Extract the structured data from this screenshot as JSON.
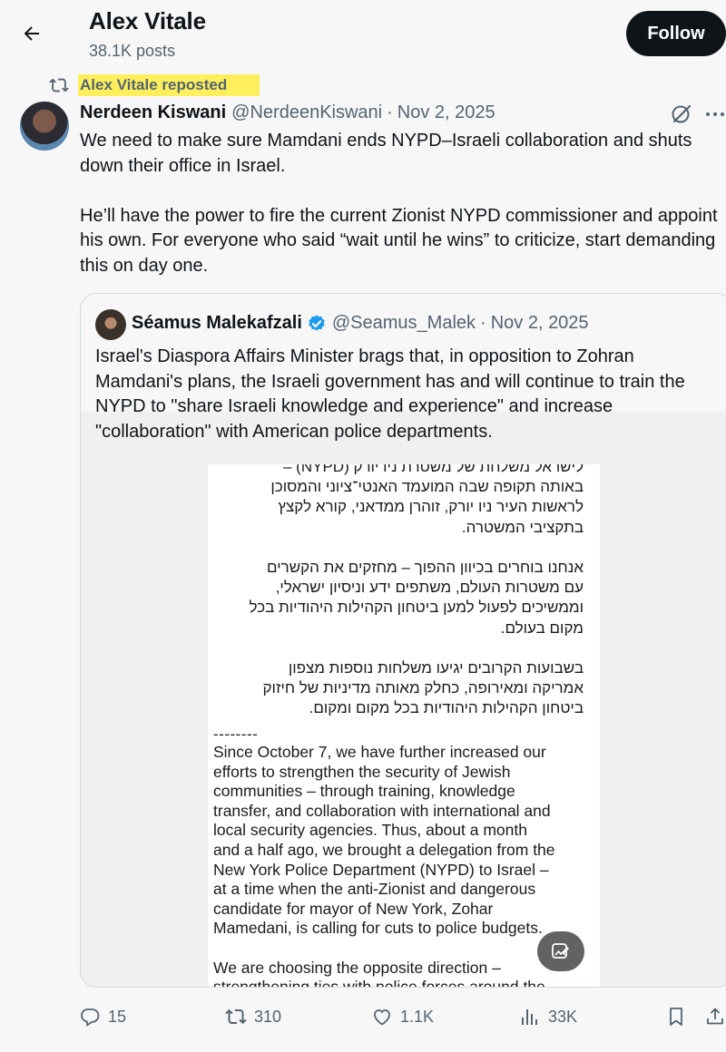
{
  "header": {
    "title": "Alex Vitale",
    "subtitle": "38.1K posts",
    "follow_label": "Follow"
  },
  "repost": {
    "text": "Alex Vitale reposted",
    "highlight_color": "#ffef5c"
  },
  "tweet": {
    "author_name": "Nerdeen Kiswani",
    "author_handle": "@NerdeenKiswani",
    "separator": "·",
    "date": "Nov 2, 2025",
    "paragraph_1": "We need to make sure Mamdani ends NYPD–Israeli collaboration and shuts down their office in Israel.",
    "paragraph_2": "He’ll have the power to fire the current Zionist NYPD commissioner and appoint his own. For everyone who said “wait until he wins” to criticize, start demanding this on day one."
  },
  "quote": {
    "author_name": "Séamus Malekafzali",
    "author_handle": "@Seamus_Malek",
    "separator": "·",
    "date": "Nov 2, 2025",
    "text": "Israel's Diaspora Affairs Minister brags that, in opposition to Zohran Mamdani's plans, the Israeli government has and will continue to train the NYPD to \"share Israeli knowledge and experience\" and increase \"collaboration\" with American police departments.",
    "image": {
      "hebrew_text": "לישראל משלחת של משטרת ניו יורק (NYPD) –\nבאותה תקופה שבה המועמד האנטי־ציוני והמסוכן\nלראשות העיר ניו יורק, זוהרן ממדאני, קורא לקצץ\nבתקציבי המשטרה.\n\nאנחנו בוחרים בכיוון ההפוך – מחזקים את הקשרים\nעם משטרות העולם, משתפים ידע וניסיון ישראלי,\nוממשיכים לפעול למען ביטחון הקהילות היהודיות בכל\nמקום בעולם.\n\nבשבועות הקרובים יגיעו משלחות נוספות מצפון\nאמריקה ומאירופה, כחלק מאותה מדיניות של חיזוק\nביטחון הקהילות היהודיות בכל מקום ומקום.",
      "divider": "--------",
      "english_text": "Since October 7, we have further increased our\nefforts to strengthen the security of Jewish\ncommunities – through training, knowledge\ntransfer, and collaboration with international and\nlocal security agencies. Thus, about a month\nand a half ago, we brought a delegation from the\nNew York Police Department (NYPD) to Israel –\nat a time when the anti-Zionist and dangerous\ncandidate for mayor of New York, Zohar\nMamedani, is calling for cuts to police budgets.\n\nWe are choosing the opposite direction –\nstrengthening ties with police forces around the"
    }
  },
  "actions": {
    "replies": "15",
    "reposts": "310",
    "likes": "1.1K",
    "views": "33K"
  },
  "icons": {
    "back": "arrow-left-icon",
    "repost": "repost-icon",
    "grok": "grok-icon",
    "more": "more-icon",
    "verified": "verified-badge-icon",
    "alt": "image-description-icon",
    "reply": "reply-icon",
    "like": "heart-icon",
    "views": "views-icon",
    "bookmark": "bookmark-icon",
    "share": "share-icon"
  },
  "colors": {
    "text_primary": "#0f1419",
    "text_secondary": "#536471",
    "verified_blue": "#1d9bf0",
    "follow_bg": "#0f1419"
  }
}
